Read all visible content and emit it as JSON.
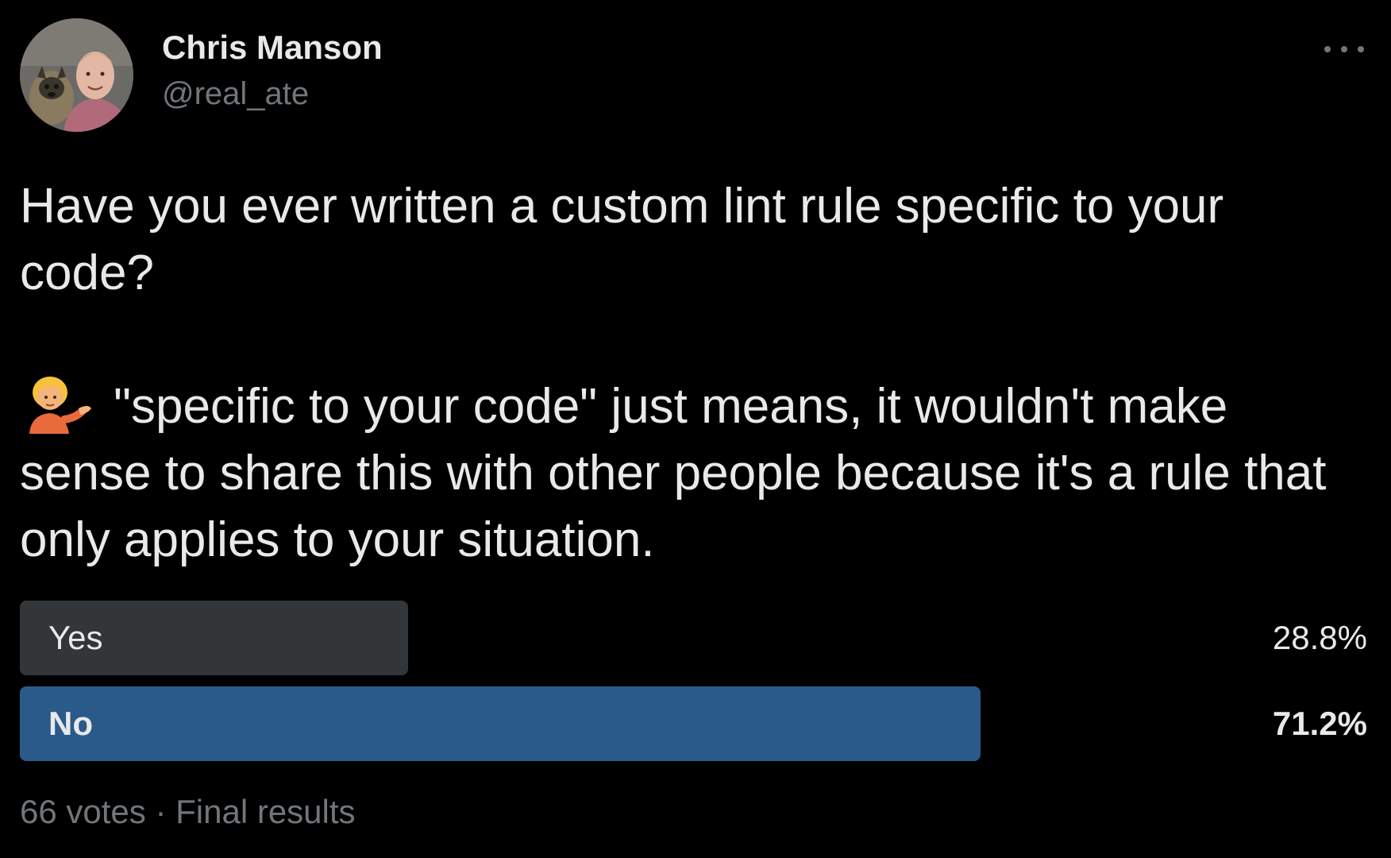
{
  "author": {
    "display_name": "Chris Manson",
    "handle": "@real_ate",
    "avatar_icon": "profile-photo"
  },
  "more_icon": "more-horizontal-icon",
  "tweet": {
    "line1": "Have you ever written a custom lint rule specific to your code?",
    "emoji_icon": "person-tipping-hand-emoji",
    "line2": "\"specific to your code\" just means, it wouldn't make sense to share this with other people because it's a rule that only applies to your situation."
  },
  "poll": {
    "options": [
      {
        "label": "Yes",
        "percent_text": "28.8%",
        "percent": 28.8,
        "bar_color": "#333639",
        "winner": false
      },
      {
        "label": "No",
        "percent_text": "71.2%",
        "percent": 71.2,
        "bar_color": "#2a5a8a",
        "winner": true
      }
    ],
    "votes": "66 votes",
    "separator": "·",
    "status": "Final results"
  },
  "colors": {
    "background": "#000000",
    "text_primary": "#e7e9ea",
    "text_secondary": "#71767b",
    "winner_bar": "#2a5a8a",
    "loser_bar": "#333639"
  }
}
